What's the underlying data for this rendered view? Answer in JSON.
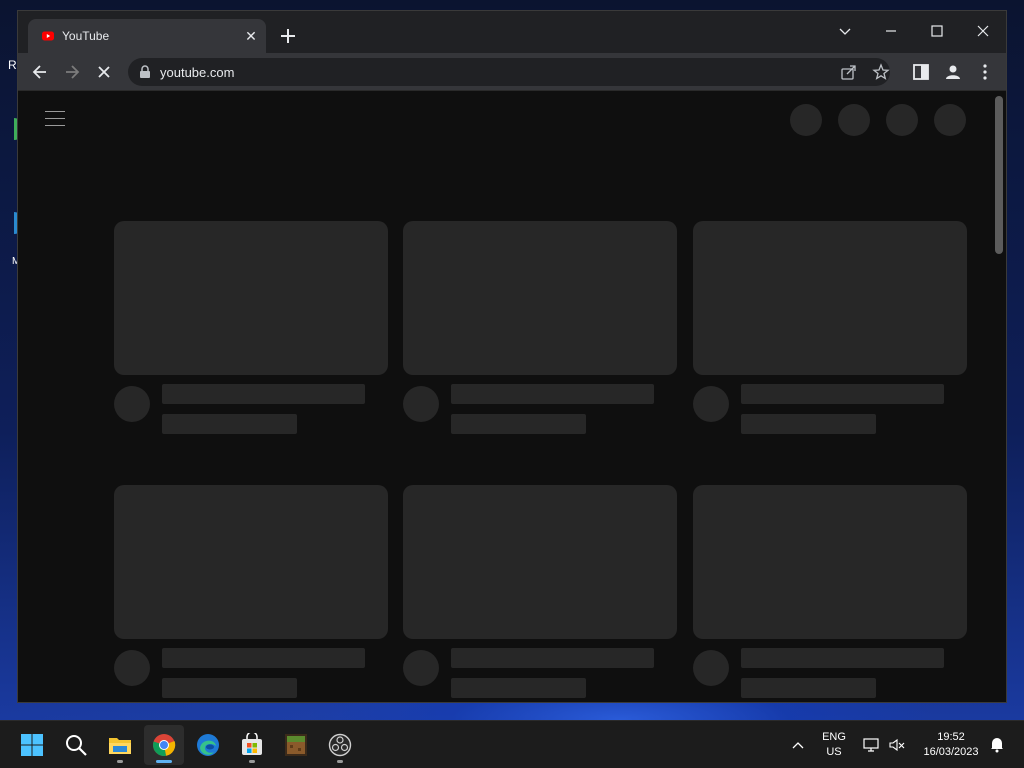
{
  "desktop": {
    "fragments": [
      "Re",
      "M"
    ]
  },
  "browser": {
    "tab": {
      "title": "YouTube",
      "close": "✕"
    },
    "new_tab": "+",
    "address": {
      "url": "youtube.com"
    }
  },
  "page": {
    "video_rows": [
      {
        "cards": [
          {},
          {},
          {}
        ]
      },
      {
        "cards": [
          {},
          {},
          {}
        ]
      }
    ]
  },
  "taskbar": {
    "apps": [
      {
        "name": "start-icon"
      },
      {
        "name": "search-icon"
      },
      {
        "name": "file-explorer-icon"
      },
      {
        "name": "chrome-icon"
      },
      {
        "name": "edge-icon"
      },
      {
        "name": "microsoft-store-icon"
      },
      {
        "name": "minecraft-icon"
      },
      {
        "name": "obs-icon"
      }
    ],
    "language": {
      "line1": "ENG",
      "line2": "US"
    },
    "clock": {
      "time": "19:52",
      "date": "16/03/2023"
    }
  },
  "colors": {
    "page_bg": "#0f0f0f",
    "skeleton": "#272727",
    "chrome_toolbar": "#35363a",
    "chrome_tabstrip": "#202124",
    "taskbar": "#1c1c1c",
    "accent": "#5fb2f2"
  }
}
